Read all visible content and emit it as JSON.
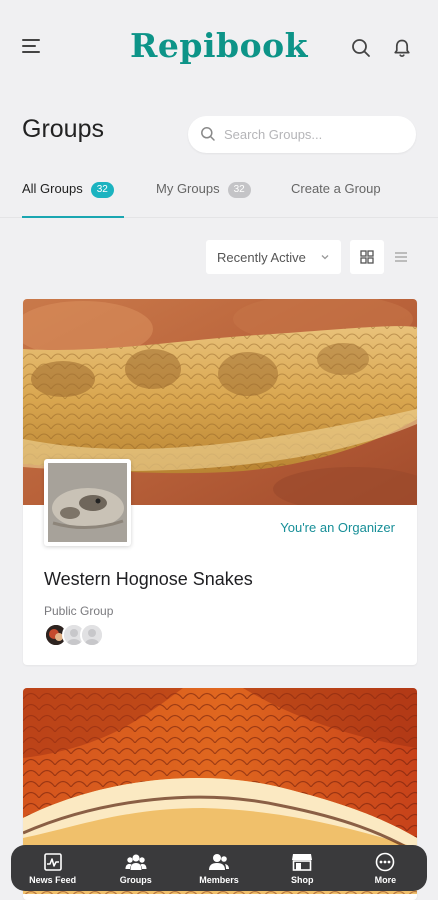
{
  "app": {
    "brand": "Repibook"
  },
  "page": {
    "title": "Groups"
  },
  "search": {
    "placeholder": "Search Groups..."
  },
  "tabs": [
    {
      "label": "All Groups",
      "count": "32",
      "active": true
    },
    {
      "label": "My Groups",
      "count": "32",
      "active": false
    },
    {
      "label": "Create a Group",
      "active": false
    }
  ],
  "filters": {
    "sort_selected": "Recently Active",
    "view_mode": "grid"
  },
  "groups": [
    {
      "name": "Western Hognose Snakes",
      "status": "You're an Organizer",
      "type": "Public Group"
    },
    {
      "name": "",
      "status": "",
      "type": ""
    }
  ],
  "bottom_nav": [
    {
      "label": "News Feed",
      "icon": "news-feed-icon"
    },
    {
      "label": "Groups",
      "icon": "groups-icon"
    },
    {
      "label": "Members",
      "icon": "members-icon"
    },
    {
      "label": "Shop",
      "icon": "shop-icon"
    },
    {
      "label": "More",
      "icon": "more-icon"
    }
  ],
  "colors": {
    "brand": "#0d9488",
    "accent": "#1bb3c0",
    "nav_bg": "#3a3a3c",
    "page_bg": "#f0f0f2"
  }
}
